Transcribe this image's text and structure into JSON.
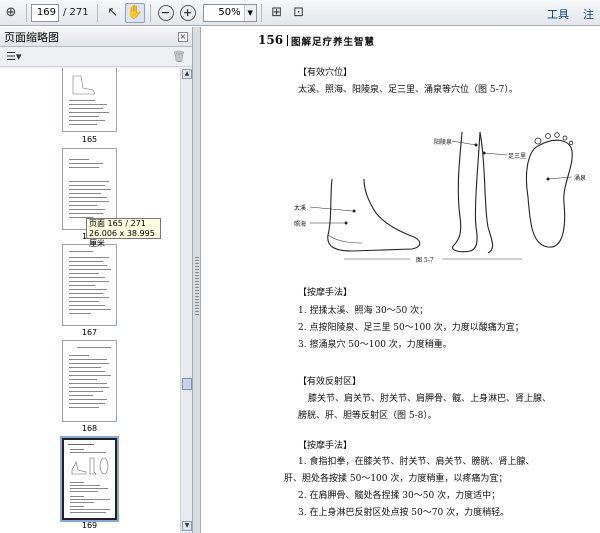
{
  "toolbar": {
    "page_current": "169",
    "page_total": "/ 271",
    "zoom": "50%",
    "menu_tools": "工具",
    "menu_comment": "注"
  },
  "sidebar": {
    "title": "页面缩略图",
    "thumbnails": [
      {
        "label": "165"
      },
      {
        "label": "166"
      },
      {
        "label": "167"
      },
      {
        "label": "168"
      },
      {
        "label": "169"
      }
    ],
    "tooltip_line1": "页面 165 / 271",
    "tooltip_line2": "26.006 x 38.995 厘米"
  },
  "document": {
    "header_number": "156",
    "header_title": "图解足疗养生智慧",
    "figure": {
      "labels": {
        "yanglingquan": "阳陵泉",
        "zusanli": "足三里",
        "taixi": "太溪",
        "zhaohai": "照海",
        "yongquan": "涌泉"
      },
      "caption": "图 5-7"
    },
    "lines": [
      "【有效穴位】",
      "太溪、照海、阳陵泉、足三里、涌泉等穴位（图 5-7）。",
      "【按摩手法】",
      "1. 捏揉太溪、照海 30～50 次；",
      "2. 点按阳陵泉、足三里 50～100 次，力度以酸痛为宜；",
      "3. 擦涌泉穴 50～100 次，力度稍重。",
      "【有效反射区】",
      "膝关节、肩关节、肘关节、肩胛骨、髋、上身淋巴、肾上腺、",
      "膀胱、肝、胆等反射区（图 5-8）。",
      "【按摩手法】",
      "1. 食指扣拳，在膝关节、肘关节、肩关节、膀胱、肾上腺、",
      "肝、胆处各按揉 50～100 次，力度稍重，以疼痛为宜；",
      "2. 在肩胛骨、髋处各捏揉 30～50 次，力度适中；",
      "3. 在上身淋巴反射区处点按 50～70 次，力度稍轻。"
    ]
  }
}
